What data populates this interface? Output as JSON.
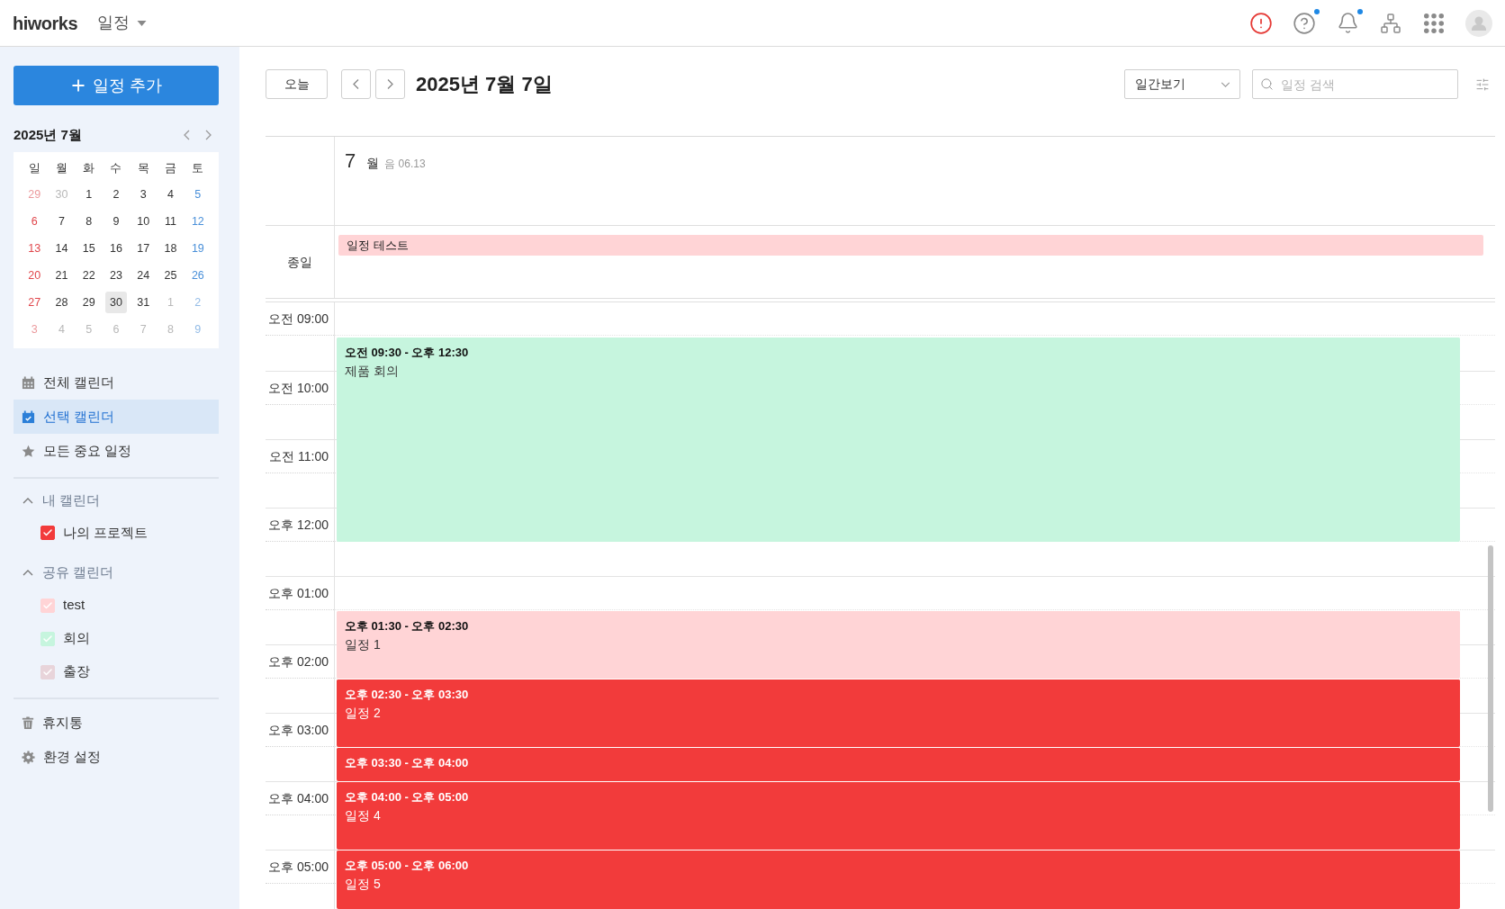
{
  "header": {
    "logo": "hiworks",
    "app": "일정",
    "icons": [
      {
        "unread": false
      },
      {
        "unread": true
      },
      {
        "unread": true
      },
      {
        "unread": false
      },
      {
        "unread": false
      }
    ]
  },
  "sidebar": {
    "add_button": "일정 추가",
    "month": "2025년 7월",
    "weekdays": [
      "일",
      "월",
      "화",
      "수",
      "목",
      "금",
      "토"
    ],
    "weeks": [
      [
        {
          "day": "29",
          "outside": true,
          "today": false
        },
        {
          "day": "30",
          "outside": true,
          "today": false
        },
        {
          "day": "1",
          "outside": false,
          "today": false
        },
        {
          "day": "2",
          "outside": false,
          "today": false
        },
        {
          "day": "3",
          "outside": false,
          "today": false
        },
        {
          "day": "4",
          "outside": false,
          "today": false
        },
        {
          "day": "5",
          "outside": false,
          "today": false
        }
      ],
      [
        {
          "day": "6",
          "outside": false,
          "today": false
        },
        {
          "day": "7",
          "outside": false,
          "today": false
        },
        {
          "day": "8",
          "outside": false,
          "today": false
        },
        {
          "day": "9",
          "outside": false,
          "today": false
        },
        {
          "day": "10",
          "outside": false,
          "today": false
        },
        {
          "day": "11",
          "outside": false,
          "today": false
        },
        {
          "day": "12",
          "outside": false,
          "today": false
        }
      ],
      [
        {
          "day": "13",
          "outside": false,
          "today": false
        },
        {
          "day": "14",
          "outside": false,
          "today": false
        },
        {
          "day": "15",
          "outside": false,
          "today": false
        },
        {
          "day": "16",
          "outside": false,
          "today": false
        },
        {
          "day": "17",
          "outside": false,
          "today": false
        },
        {
          "day": "18",
          "outside": false,
          "today": false
        },
        {
          "day": "19",
          "outside": false,
          "today": false
        }
      ],
      [
        {
          "day": "20",
          "outside": false,
          "today": false
        },
        {
          "day": "21",
          "outside": false,
          "today": false
        },
        {
          "day": "22",
          "outside": false,
          "today": false
        },
        {
          "day": "23",
          "outside": false,
          "today": false
        },
        {
          "day": "24",
          "outside": false,
          "today": false
        },
        {
          "day": "25",
          "outside": false,
          "today": false
        },
        {
          "day": "26",
          "outside": false,
          "today": false
        }
      ],
      [
        {
          "day": "27",
          "outside": false,
          "today": false
        },
        {
          "day": "28",
          "outside": false,
          "today": false
        },
        {
          "day": "29",
          "outside": false,
          "today": false
        },
        {
          "day": "30",
          "outside": false,
          "today": true
        },
        {
          "day": "31",
          "outside": false,
          "today": false
        },
        {
          "day": "1",
          "outside": true,
          "today": false
        },
        {
          "day": "2",
          "outside": true,
          "today": false
        }
      ],
      [
        {
          "day": "3",
          "outside": true,
          "today": false
        },
        {
          "day": "4",
          "outside": true,
          "today": false
        },
        {
          "day": "5",
          "outside": true,
          "today": false
        },
        {
          "day": "6",
          "outside": true,
          "today": false
        },
        {
          "day": "7",
          "outside": true,
          "today": false
        },
        {
          "day": "8",
          "outside": true,
          "today": false
        },
        {
          "day": "9",
          "outside": true,
          "today": false
        }
      ]
    ],
    "nav": [
      {
        "label": "전체 캘린더",
        "selected": false
      },
      {
        "label": "선택 캘린더",
        "selected": true
      },
      {
        "label": "모든 중요 일정",
        "selected": false
      }
    ],
    "sections": [
      {
        "title": "내 캘린더",
        "expanded": true,
        "items": [
          {
            "label": "나의 프로젝트",
            "checked": true,
            "color": "#f23b3b"
          }
        ]
      },
      {
        "title": "공유 캘린더",
        "expanded": true,
        "items": [
          {
            "label": "test",
            "checked": true,
            "color": "#ffd4d6"
          },
          {
            "label": "회의",
            "checked": true,
            "color": "#c6f5de"
          },
          {
            "label": "출장",
            "checked": true,
            "color": "#e8d4da"
          }
        ]
      }
    ],
    "bottom_links": [
      "휴지통",
      "환경 설정"
    ]
  },
  "toolbar": {
    "today": "오늘",
    "title": "2025년 7월 7일",
    "view": "일간보기",
    "search": {
      "placeholder": "일정 검색"
    }
  },
  "day_view": {
    "date": "7",
    "weekday": "월",
    "lunar": "음 06.13",
    "all_day_label": "종일",
    "all_day_events": [
      {
        "title": "일정 테스트",
        "color": "#ffd4d6"
      }
    ],
    "hours": [
      "오전 09:00",
      "오전 10:00",
      "오전 11:00",
      "오후 12:00",
      "오후 01:00",
      "오후 02:00",
      "오후 03:00",
      "오후 04:00",
      "오후 05:00"
    ],
    "events": [
      {
        "time": "오전 09:30 - 오후 12:30",
        "title": "제품 회의",
        "color": "#c6f5de"
      },
      {
        "time": "오후 01:30 - 오후 02:30",
        "title": "일정 1",
        "color": "#ffd4d6"
      },
      {
        "time": "오후 02:30 - 오후 03:30",
        "title": "일정 2",
        "color": "#f23b3b"
      },
      {
        "time": "오후 03:30 - 오후 04:00",
        "color": "#f23b3b"
      },
      {
        "time": "오후 04:00 - 오후 05:00",
        "title": "일정 4",
        "color": "#f23b3b"
      },
      {
        "time": "오후 05:00 - 오후 06:00",
        "title": "일정 5",
        "color": "#f23b3b"
      }
    ]
  }
}
